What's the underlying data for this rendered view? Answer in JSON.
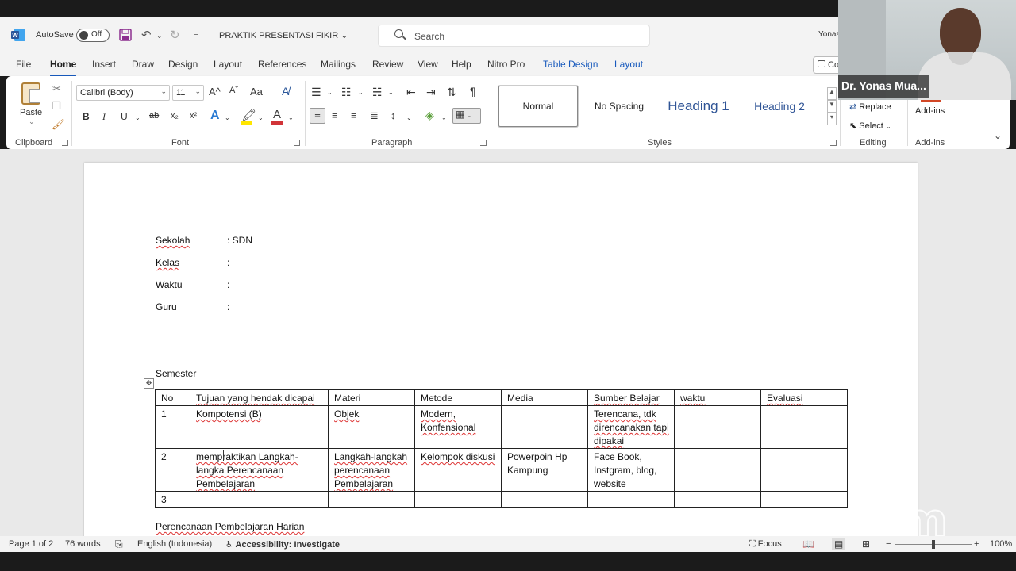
{
  "app": {
    "autosave_label": "AutoSave",
    "autosave_state": "Off",
    "document_title": "PRAKTIK PRESENTASI FIKIR",
    "search_placeholder": "Search",
    "user_name": "Yonas",
    "comments_label": "Co"
  },
  "menu": {
    "tabs": [
      "File",
      "Home",
      "Insert",
      "Draw",
      "Design",
      "Layout",
      "References",
      "Mailings",
      "Review",
      "View",
      "Help",
      "Nitro Pro",
      "Table Design",
      "Layout"
    ],
    "active_tab": "Home"
  },
  "ribbon": {
    "clipboard": {
      "paste_label": "Paste",
      "group_label": "Clipboard"
    },
    "font": {
      "font_name": "Calibri (Body)",
      "font_size": "11",
      "group_label": "Font",
      "bold": "B",
      "italic": "I",
      "underline": "U",
      "strike": "ab",
      "subscript": "x₂",
      "superscript": "x²",
      "grow": "A^",
      "shrink": "Aˇ",
      "case": "Aa",
      "text_effect": "A",
      "font_color": "A"
    },
    "paragraph": {
      "group_label": "Paragraph"
    },
    "styles": {
      "group_label": "Styles",
      "items": [
        "Normal",
        "No Spacing",
        "Heading 1",
        "Heading 2"
      ]
    },
    "editing": {
      "group_label": "Editing",
      "replace": "Replace",
      "select": "Select"
    },
    "addins": {
      "label": "Add-ins",
      "group_label": "Add-ins"
    }
  },
  "video": {
    "participant_name": "Dr. Yonas Mua..."
  },
  "document": {
    "fields": [
      {
        "label": "Sekolah",
        "value": ": SDN"
      },
      {
        "label": "Kelas",
        "value": ":"
      },
      {
        "label": "Waktu",
        "value": ":"
      },
      {
        "label": "Guru",
        "value": ":"
      }
    ],
    "semester_label": "Semester",
    "table": {
      "headers": [
        "No",
        "Tujuan yang hendak dicapai",
        "Materi",
        "Metode",
        "Media",
        "Sumber Belajar",
        "waktu",
        "Evaluasi"
      ],
      "rows": [
        [
          "1",
          "Kompotensi (B)",
          "Objek",
          "Modern, Konfensional",
          "",
          "Terencana, tdk direncanakan tapi dipakai",
          "",
          ""
        ],
        [
          "2",
          "mempraktikan Langkah-langka Perencanaan Pembelajaran",
          "Langkah-langkah perencanaan Pembelajaran",
          "Kelompok diskusi",
          "Powerpoin Hp Kampung",
          "Face Book, Instgram, blog, website",
          "",
          ""
        ],
        [
          "3",
          "",
          "",
          "",
          "",
          "",
          "",
          ""
        ]
      ]
    },
    "footer_text": "Perencanaan Pembelajaran Harian"
  },
  "status": {
    "page": "Page 1 of 2",
    "words": "76 words",
    "language": "English (Indonesia)",
    "accessibility": "Accessibility: Investigate",
    "focus": "Focus",
    "zoom_minus": "−",
    "zoom_plus": "+",
    "zoom_level": "100%"
  },
  "watermark": "zoom",
  "colors": {
    "accent": "#185abd",
    "word_blue": "#2b579a",
    "font_red": "#d13438",
    "highlight_yellow": "#ffe600"
  }
}
